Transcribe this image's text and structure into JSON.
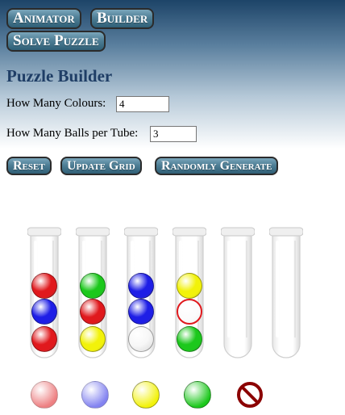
{
  "nav": {
    "animator_label": "Animator",
    "builder_label": "Builder",
    "solve_label": "Solve Puzzle"
  },
  "page_title": "Puzzle Builder",
  "form": {
    "colours_label": "How Many Colours:",
    "colours_value": "4",
    "balls_label": "How Many Balls per Tube:",
    "balls_value": "3"
  },
  "actions": {
    "reset_label": "Reset",
    "update_label": "Update Grid",
    "random_label": "Randomly Generate"
  },
  "colors": {
    "red": "#e0191d",
    "blue": "#1e1ee6",
    "green": "#1cc81c",
    "yellow": "#f2f20a",
    "empty": "#f4f4f4",
    "highlight": "#e0191d"
  },
  "tubes": [
    {
      "balls": [
        "red",
        "blue",
        "red"
      ],
      "highlight": null
    },
    {
      "balls": [
        "green",
        "red",
        "yellow"
      ],
      "highlight": null
    },
    {
      "balls": [
        "blue",
        "blue",
        "empty"
      ],
      "highlight": null
    },
    {
      "balls": [
        "yellow",
        "empty",
        "green"
      ],
      "highlight": 1
    },
    {
      "balls": [],
      "highlight": null
    },
    {
      "balls": [],
      "highlight": null
    }
  ],
  "palette": [
    "red",
    "blue",
    "yellow",
    "green"
  ],
  "palette_erase_icon": "no-entry-icon"
}
